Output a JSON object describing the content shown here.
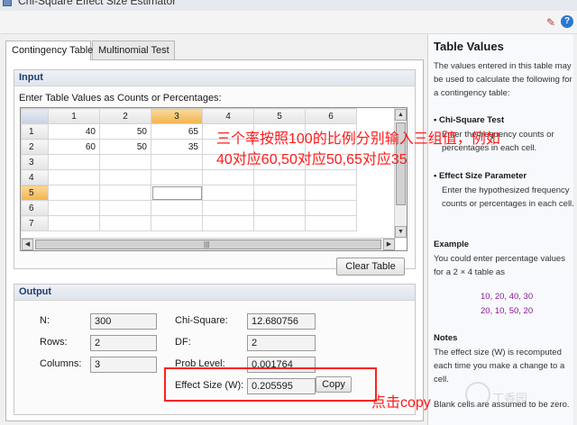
{
  "window": {
    "title": "Chi-Square Effect Size Estimator"
  },
  "tabs": [
    {
      "label": "Contingency Table",
      "active": true
    },
    {
      "label": "Multinomial Test",
      "active": false
    }
  ],
  "input": {
    "header": "Input",
    "caption": "Enter Table Values as Counts or Percentages:",
    "columns": [
      "1",
      "2",
      "3",
      "4",
      "5",
      "6"
    ],
    "rows": [
      {
        "label": "1",
        "cells": [
          "40",
          "50",
          "65",
          "",
          "",
          ""
        ]
      },
      {
        "label": "2",
        "cells": [
          "60",
          "50",
          "35",
          "",
          "",
          ""
        ]
      },
      {
        "label": "3",
        "cells": [
          "",
          "",
          "",
          "",
          "",
          ""
        ]
      },
      {
        "label": "4",
        "cells": [
          "",
          "",
          "",
          "",
          "",
          ""
        ]
      },
      {
        "label": "5",
        "cells": [
          "",
          "",
          "",
          "",
          "",
          ""
        ]
      },
      {
        "label": "6",
        "cells": [
          "",
          "",
          "",
          "",
          "",
          ""
        ]
      },
      {
        "label": "7",
        "cells": [
          "",
          "",
          "",
          "",
          "",
          ""
        ]
      }
    ],
    "selected_column": "3",
    "selected_row": "5",
    "clear_label": "Clear Table"
  },
  "output": {
    "header": "Output",
    "n_label": "N:",
    "n_value": "300",
    "rows_label": "Rows:",
    "rows_value": "2",
    "columns_label": "Columns:",
    "columns_value": "3",
    "chi_label": "Chi-Square:",
    "chi_value": "12.680756",
    "df_label": "DF:",
    "df_value": "2",
    "prob_label": "Prob Level:",
    "prob_value": "0.001764",
    "effect_label": "Effect Size (W):",
    "effect_value": "0.205595",
    "copy_label": "Copy"
  },
  "help": {
    "title": "Table Values",
    "intro": "The values entered in this table may be used to calculate the following for a contingency table:",
    "b1_title": "• Chi-Square Test",
    "b1_text": "Enter the frequency counts or percentages in each cell.",
    "b2_title": "• Effect Size Parameter",
    "b2_text": "Enter the hypothesized frequency counts or percentages in each cell.",
    "example_title": "Example",
    "example_text": "You could enter percentage values for a 2 × 4 table as",
    "example_line1": "10, 20, 40, 30",
    "example_line2": "20, 10, 50, 20",
    "notes_title": "Notes",
    "notes_text": "The effect size (W) is recomputed each time you make a change to a cell.",
    "notes_text2": "Blank cells are assumed to be zero."
  },
  "annotations": {
    "main_line1": "三个率按照100的比例分别输入三组值，例如",
    "main_line2": "40对应60,50对应50,65对应35",
    "copy_hint": "点击copy"
  },
  "watermark": {
    "text": "丁香园"
  },
  "colors": {
    "annotation": "#ff1a1a",
    "header_text": "#1f3c6e",
    "selected_header": "#f2b44f",
    "example_text": "#8a1a9a"
  }
}
